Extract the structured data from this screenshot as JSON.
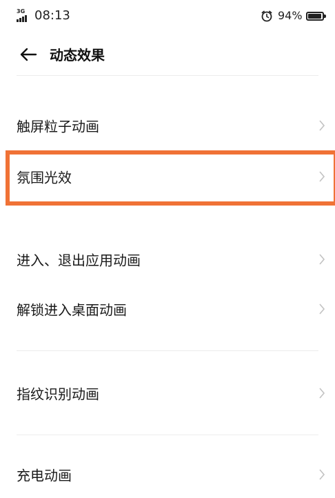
{
  "status": {
    "network": "3G",
    "time": "08:13",
    "battery_percent": "94%",
    "battery_level": 0.94,
    "icons": [
      "signal-icon",
      "alarm-icon",
      "battery-icon"
    ]
  },
  "header": {
    "back_icon": "arrow-left-icon",
    "title": "动态效果"
  },
  "items": [
    {
      "label": "触屏粒子动画"
    },
    {
      "label": "氛围光效"
    },
    {
      "label": "进入、退出应用动画"
    },
    {
      "label": "解锁进入桌面动画"
    },
    {
      "label": "指纹识别动画"
    },
    {
      "label": "充电动画"
    }
  ],
  "highlight": {
    "target": "氛围光效",
    "color": "#f07236"
  }
}
